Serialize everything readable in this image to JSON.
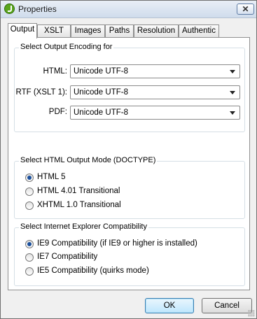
{
  "window": {
    "title": "Properties",
    "close_symbol": "✕"
  },
  "tabs": [
    {
      "label": "Output",
      "active": true
    },
    {
      "label": "XSLT"
    },
    {
      "label": "Images"
    },
    {
      "label": "Paths"
    },
    {
      "label": "Resolution"
    },
    {
      "label": "Authentic"
    }
  ],
  "encoding": {
    "group_title": "Select Output Encoding for",
    "rows": [
      {
        "label": "HTML:",
        "value": "Unicode UTF-8"
      },
      {
        "label": "RTF (XSLT 1):",
        "value": "Unicode UTF-8"
      },
      {
        "label": "PDF:",
        "value": "Unicode UTF-8"
      }
    ]
  },
  "html_mode": {
    "group_title": "Select HTML Output Mode (DOCTYPE)",
    "options": [
      {
        "label": "HTML 5",
        "selected": true
      },
      {
        "label": "HTML 4.01 Transitional",
        "selected": false
      },
      {
        "label": "XHTML 1.0 Transitional",
        "selected": false
      }
    ]
  },
  "ie_compat": {
    "group_title": "Select Internet Explorer Compatibility",
    "options": [
      {
        "label": "IE9 Compatibility (if IE9 or higher is installed)",
        "selected": true
      },
      {
        "label": "IE7 Compatibility",
        "selected": false
      },
      {
        "label": "IE5 Compatibility (quirks mode)",
        "selected": false
      }
    ]
  },
  "buttons": {
    "ok": "OK",
    "cancel": "Cancel"
  },
  "colors": {
    "titlebar": "#cfdcec",
    "selected_radio": "#1a4f9c",
    "default_button": "#bee6fd"
  }
}
